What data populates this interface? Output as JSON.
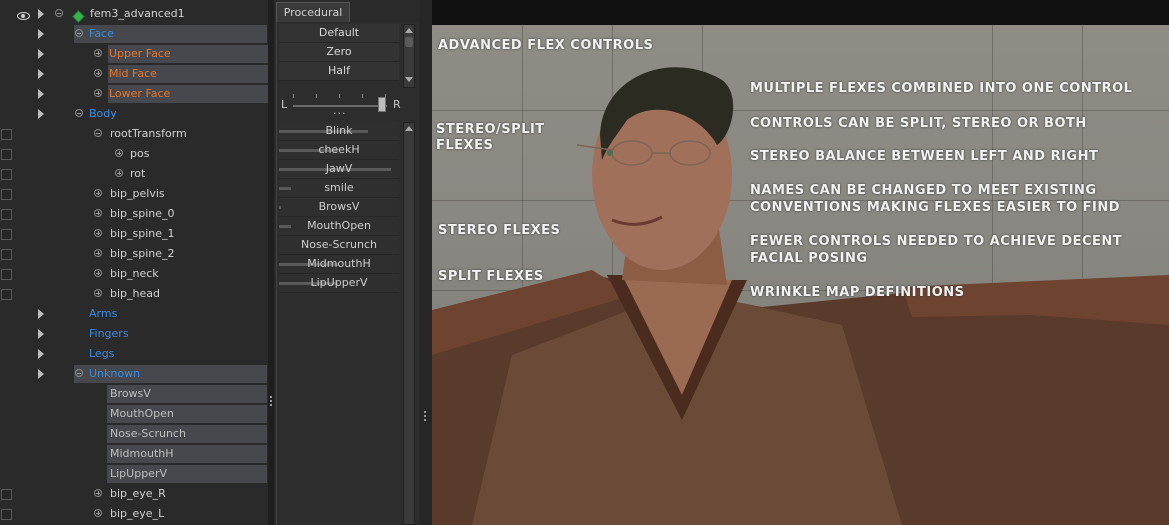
{
  "tree": {
    "root": "fem3_advanced1",
    "items": [
      {
        "label": "Face",
        "color": "blue"
      },
      {
        "label": "Upper Face",
        "color": "orange"
      },
      {
        "label": "Mid Face",
        "color": "orange"
      },
      {
        "label": "Lower Face",
        "color": "orange"
      },
      {
        "label": "Body",
        "color": "blue"
      },
      {
        "label": "rootTransform",
        "color": "white"
      },
      {
        "label": "pos",
        "color": "white"
      },
      {
        "label": "rot",
        "color": "white"
      },
      {
        "label": "bip_pelvis",
        "color": "white"
      },
      {
        "label": "bip_spine_0",
        "color": "white"
      },
      {
        "label": "bip_spine_1",
        "color": "white"
      },
      {
        "label": "bip_spine_2",
        "color": "white"
      },
      {
        "label": "bip_neck",
        "color": "white"
      },
      {
        "label": "bip_head",
        "color": "white"
      },
      {
        "label": "Arms",
        "color": "blue"
      },
      {
        "label": "Fingers",
        "color": "blue"
      },
      {
        "label": "Legs",
        "color": "blue"
      },
      {
        "label": "Unknown",
        "color": "blue"
      },
      {
        "label": "BrowsV",
        "color": "gray"
      },
      {
        "label": "MouthOpen",
        "color": "gray"
      },
      {
        "label": "Nose-Scrunch",
        "color": "gray"
      },
      {
        "label": "MidmouthH",
        "color": "gray"
      },
      {
        "label": "LipUpperV",
        "color": "gray"
      },
      {
        "label": "bip_eye_R",
        "color": "white"
      },
      {
        "label": "bip_eye_L",
        "color": "white"
      }
    ]
  },
  "procedural": {
    "tab": "Procedural",
    "presets": [
      "Default",
      "Zero",
      "Half"
    ],
    "balance": {
      "left": "L",
      "right": "R",
      "value": 0.95
    },
    "flexes": [
      {
        "label": "Blink",
        "value": 0.75
      },
      {
        "label": "cheekH",
        "value": 0.5
      },
      {
        "label": "JawV",
        "value": 0.95
      },
      {
        "label": "smile",
        "value": 0.1
      },
      {
        "label": "BrowsV",
        "value": 0.02
      },
      {
        "label": "MouthOpen",
        "value": 0.1
      },
      {
        "label": "Nose-Scrunch",
        "value": 0.0
      },
      {
        "label": "MidmouthH",
        "value": 0.5
      },
      {
        "label": "LipUpperV",
        "value": 0.5
      }
    ]
  },
  "viewport": {
    "captions": {
      "advanced": "ADVANCED FLEX CONTROLS",
      "stereo_split_1": "STEREO/SPLIT",
      "stereo_split_2": "FLEXES",
      "stereo": "STEREO FLEXES",
      "split": "SPLIT FLEXES",
      "multiple": "MULTIPLE FLEXES COMBINED INTO ONE CONTROL",
      "controls": "CONTROLS CAN BE SPLIT, STEREO OR BOTH",
      "balance": "STEREO BALANCE BETWEEN LEFT AND RIGHT",
      "names_1": "NAMES CAN BE CHANGED TO MEET EXISTING",
      "names_2": "CONVENTIONS MAKING FLEXES EASIER TO FIND",
      "fewer_1": "FEWER CONTROLS NEEDED TO ACHIEVE DECENT",
      "fewer_2": "FACIAL POSING",
      "wrinkle": "WRINKLE MAP DEFINITIONS"
    }
  },
  "colors": {
    "blue": "#3b8de0",
    "orange": "#e6782c",
    "white": "#d2d2d2",
    "gray": "#bfbfbf"
  }
}
